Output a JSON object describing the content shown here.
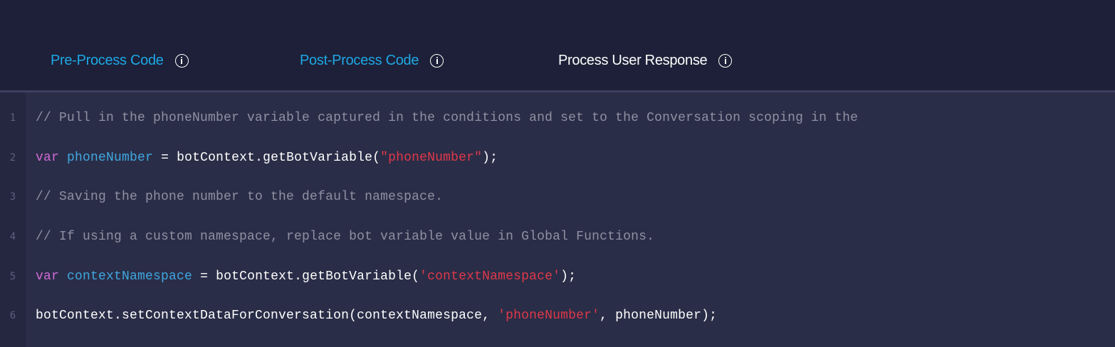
{
  "tabs": [
    {
      "label": "Pre-Process Code",
      "state": "link"
    },
    {
      "label": "Post-Process Code",
      "state": "link"
    },
    {
      "label": "Process User Response",
      "state": "active"
    }
  ],
  "colors": {
    "header_bg": "#1d2038",
    "editor_bg": "#2a2d47",
    "link_blue": "#1ea7e4",
    "comment": "#8e91a3",
    "keyword": "#d16ad6",
    "variable": "#3fa7e0",
    "string": "#e0384a"
  },
  "editor": {
    "lines": [
      {
        "number": "1",
        "tokens": [
          {
            "type": "comment",
            "text": "// Pull in the phoneNumber variable captured in the conditions and set to the Conversation scoping in the"
          }
        ]
      },
      {
        "number": "2",
        "tokens": [
          {
            "type": "kw",
            "text": "var"
          },
          {
            "type": "plain",
            "text": " "
          },
          {
            "type": "var",
            "text": "phoneNumber"
          },
          {
            "type": "plain",
            "text": " = botContext.getBotVariable("
          },
          {
            "type": "str",
            "text": "\"phoneNumber\""
          },
          {
            "type": "plain",
            "text": ");"
          }
        ]
      },
      {
        "number": "3",
        "tokens": [
          {
            "type": "comment",
            "text": "// Saving the phone number to the default namespace."
          }
        ]
      },
      {
        "number": "4",
        "tokens": [
          {
            "type": "comment",
            "text": "// If using a custom namespace, replace bot variable value in Global Functions."
          }
        ]
      },
      {
        "number": "5",
        "tokens": [
          {
            "type": "kw",
            "text": "var"
          },
          {
            "type": "plain",
            "text": " "
          },
          {
            "type": "var",
            "text": "contextNamespace"
          },
          {
            "type": "plain",
            "text": " = botContext.getBotVariable("
          },
          {
            "type": "str",
            "text": "'contextNamespace'"
          },
          {
            "type": "plain",
            "text": ");"
          }
        ]
      },
      {
        "number": "6",
        "tokens": [
          {
            "type": "plain",
            "text": "botContext.setContextDataForConversation(contextNamespace, "
          },
          {
            "type": "str",
            "text": "'phoneNumber'"
          },
          {
            "type": "plain",
            "text": ", phoneNumber);"
          }
        ]
      }
    ]
  }
}
